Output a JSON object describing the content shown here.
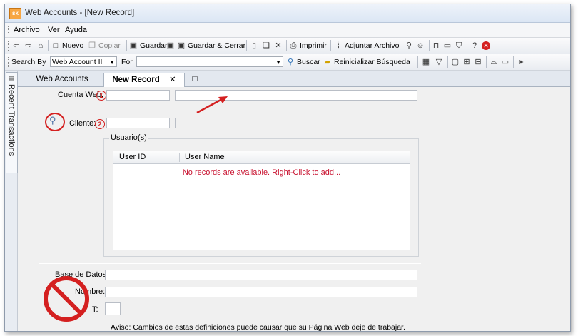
{
  "window": {
    "title": "Web Accounts - [New Record]",
    "app_icon": "app-logo-icon"
  },
  "menu": {
    "items": [
      "Archivo",
      "Ver",
      "Ayuda"
    ]
  },
  "toolbar": {
    "nuevo": "Nuevo",
    "copiar": "Copiar",
    "guardar": "Guardar",
    "guardar_cerrar": "Guardar & Cerrar",
    "imprimir": "Imprimir",
    "adjuntar": "Adjuntar Archivo"
  },
  "searchbar": {
    "search_by_label": "Search By",
    "search_by_value": "Web Account II",
    "for_label": "For",
    "for_value": "",
    "buscar": "Buscar",
    "reinicializar": "Reinicializar Búsqueda"
  },
  "sidebar": {
    "recent_label": "Recent Transactions"
  },
  "tabs": [
    {
      "label": "Web Accounts",
      "active": false
    },
    {
      "label": "New Record",
      "active": true
    }
  ],
  "form": {
    "cuenta_web_label": "Cuenta Web:",
    "cliente_label": "Cliente:",
    "callout_1": "1",
    "callout_2": "2",
    "cuenta_web_value": "",
    "cliente_value": ""
  },
  "usuarios": {
    "legend": "Usuario(s)",
    "columns": [
      "User ID",
      "User Name"
    ],
    "empty_message": "No records are available. Right-Click to add..."
  },
  "lower": {
    "base_datos_label": "Base de Datos:",
    "nombre_label": "Nombre:",
    "t_label": "T:",
    "aviso": "Aviso: Cambios de estas definiciones puede causar que su Página Web deje de trabajar."
  },
  "colors": {
    "annotation_red": "#d42020",
    "empty_text": "#c8102e",
    "accent": "#f7a642"
  }
}
